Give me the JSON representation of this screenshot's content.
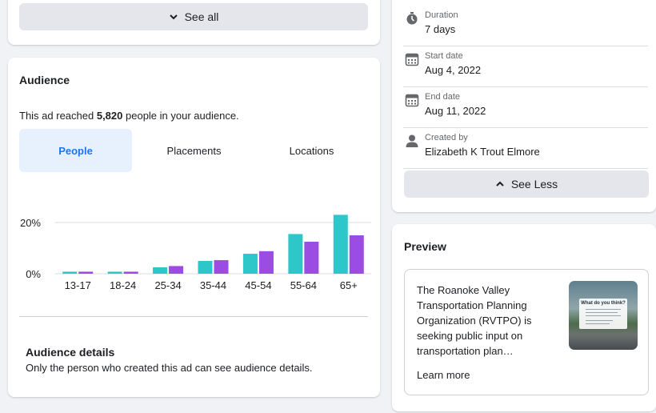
{
  "top_card": {
    "see_all_label": "See all"
  },
  "audience": {
    "title": "Audience",
    "reach_prefix": "This ad reached ",
    "reach_count": "5,820",
    "reach_suffix": " people in your audience.",
    "tabs": [
      {
        "label": "People",
        "active": true
      },
      {
        "label": "Placements",
        "active": false
      },
      {
        "label": "Locations",
        "active": false
      }
    ],
    "details_title": "Audience details",
    "details_text": "Only the person who created this ad can see audience details."
  },
  "chart_data": {
    "type": "bar",
    "categories": [
      "13-17",
      "18-24",
      "25-34",
      "35-44",
      "45-54",
      "55-64",
      "65+"
    ],
    "series": [
      {
        "values": [
          0.8,
          0.8,
          2.5,
          5.0,
          7.8,
          15.5,
          23.0
        ],
        "color": "#2ec7c9"
      },
      {
        "values": [
          0.8,
          0.8,
          3.0,
          5.3,
          8.8,
          12.5,
          15.0
        ],
        "color": "#9b4de3"
      }
    ],
    "yticks": [
      "0%",
      "20%"
    ],
    "ylim": [
      0,
      25
    ],
    "grid": true
  },
  "details": {
    "rows": [
      {
        "label": "Duration",
        "value": "7 days",
        "icon": "stopwatch-icon"
      },
      {
        "label": "Start date",
        "value": "Aug 4, 2022",
        "icon": "calendar-icon"
      },
      {
        "label": "End date",
        "value": "Aug 11, 2022",
        "icon": "calendar-icon"
      },
      {
        "label": "Created by",
        "value": "Elizabeth K Trout Elmore",
        "icon": "person-icon"
      }
    ],
    "see_less_label": "See Less"
  },
  "preview": {
    "title": "Preview",
    "text": "The Roanoke Valley Transportation Planning Organization (RVTPO) is seeking public input on transportation plan…",
    "learn_more": "Learn more",
    "thumbnail_heading": "What do you think?"
  },
  "colors": {
    "accent": "#1877f2",
    "tab_active_bg": "#e7f0fd",
    "series_teal": "#2ec7c9",
    "series_purple": "#9b4de3"
  }
}
